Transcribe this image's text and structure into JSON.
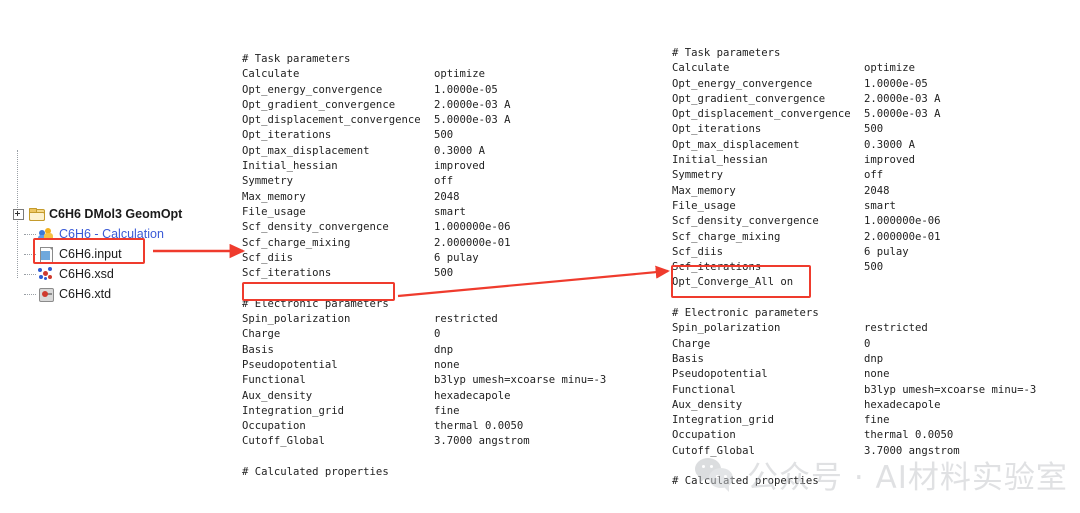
{
  "tree": {
    "root": {
      "label": "C6H6 DMol3 GeomOpt",
      "icon": "folder-icon"
    },
    "items": [
      {
        "label": "C6H6 - Calculation",
        "icon": "calculation-icon"
      },
      {
        "label": "C6H6.input",
        "icon": "document-icon"
      },
      {
        "label": "C6H6.xsd",
        "icon": "molecule-icon"
      },
      {
        "label": "C6H6.xtd",
        "icon": "trajectory-icon"
      }
    ]
  },
  "left_file": {
    "lines": [
      {
        "key": "# Task parameters",
        "value": ""
      },
      {
        "key": "Calculate",
        "value": "optimize"
      },
      {
        "key": "Opt_energy_convergence",
        "value": "1.0000e-05"
      },
      {
        "key": "Opt_gradient_convergence",
        "value": "2.0000e-03 A"
      },
      {
        "key": "Opt_displacement_convergence",
        "value": "5.0000e-03 A"
      },
      {
        "key": "Opt_iterations",
        "value": "500"
      },
      {
        "key": "Opt_max_displacement",
        "value": "0.3000 A"
      },
      {
        "key": "Initial_hessian",
        "value": "improved"
      },
      {
        "key": "Symmetry",
        "value": "off"
      },
      {
        "key": "Max_memory",
        "value": "2048"
      },
      {
        "key": "File_usage",
        "value": "smart"
      },
      {
        "key": "Scf_density_convergence",
        "value": "1.000000e-06"
      },
      {
        "key": "Scf_charge_mixing",
        "value": "2.000000e-01"
      },
      {
        "key": "Scf_diis",
        "value": "6 pulay"
      },
      {
        "key": "Scf_iterations",
        "value": "500"
      },
      {
        "key": "",
        "value": ""
      },
      {
        "key": "# Electronic parameters",
        "value": ""
      },
      {
        "key": "Spin_polarization",
        "value": "restricted"
      },
      {
        "key": "Charge",
        "value": "0"
      },
      {
        "key": "Basis",
        "value": "dnp"
      },
      {
        "key": "Pseudopotential",
        "value": "none"
      },
      {
        "key": "Functional",
        "value": "b3lyp umesh=xcoarse minu=-3"
      },
      {
        "key": "Aux_density",
        "value": "hexadecapole"
      },
      {
        "key": "Integration_grid",
        "value": "fine"
      },
      {
        "key": "Occupation",
        "value": "thermal 0.0050"
      },
      {
        "key": "Cutoff_Global",
        "value": "3.7000 angstrom"
      },
      {
        "key": "",
        "value": ""
      },
      {
        "key": "# Calculated properties",
        "value": ""
      }
    ]
  },
  "right_file": {
    "lines": [
      {
        "key": "# Task parameters",
        "value": ""
      },
      {
        "key": "Calculate",
        "value": "optimize"
      },
      {
        "key": "Opt_energy_convergence",
        "value": "1.0000e-05"
      },
      {
        "key": "Opt_gradient_convergence",
        "value": "2.0000e-03 A"
      },
      {
        "key": "Opt_displacement_convergence",
        "value": "5.0000e-03 A"
      },
      {
        "key": "Opt_iterations",
        "value": "500"
      },
      {
        "key": "Opt_max_displacement",
        "value": "0.3000 A"
      },
      {
        "key": "Initial_hessian",
        "value": "improved"
      },
      {
        "key": "Symmetry",
        "value": "off"
      },
      {
        "key": "Max_memory",
        "value": "2048"
      },
      {
        "key": "File_usage",
        "value": "smart"
      },
      {
        "key": "Scf_density_convergence",
        "value": "1.000000e-06"
      },
      {
        "key": "Scf_charge_mixing",
        "value": "2.000000e-01"
      },
      {
        "key": "Scf_diis",
        "value": "6 pulay"
      },
      {
        "key": "Scf_iterations",
        "value": "500"
      },
      {
        "key": "Opt_Converge_All on",
        "value": ""
      },
      {
        "key": "",
        "value": ""
      },
      {
        "key": "# Electronic parameters",
        "value": ""
      },
      {
        "key": "Spin_polarization",
        "value": "restricted"
      },
      {
        "key": "Charge",
        "value": "0"
      },
      {
        "key": "Basis",
        "value": "dnp"
      },
      {
        "key": "Pseudopotential",
        "value": "none"
      },
      {
        "key": "Functional",
        "value": "b3lyp umesh=xcoarse minu=-3"
      },
      {
        "key": "Aux_density",
        "value": "hexadecapole"
      },
      {
        "key": "Integration_grid",
        "value": "fine"
      },
      {
        "key": "Occupation",
        "value": "thermal 0.0050"
      },
      {
        "key": "Cutoff_Global",
        "value": "3.7000 angstrom"
      },
      {
        "key": "",
        "value": ""
      },
      {
        "key": "# Calculated properties",
        "value": ""
      }
    ]
  },
  "annotations": {
    "highlight_color": "#ef3b2d",
    "file_box_target": "C6H6.input",
    "insert_box_caption": "",
    "added_line": "Opt_Converge_All on"
  },
  "watermark": {
    "text": "公众号 · AI材料实验室",
    "logo": "wechat-icon"
  }
}
